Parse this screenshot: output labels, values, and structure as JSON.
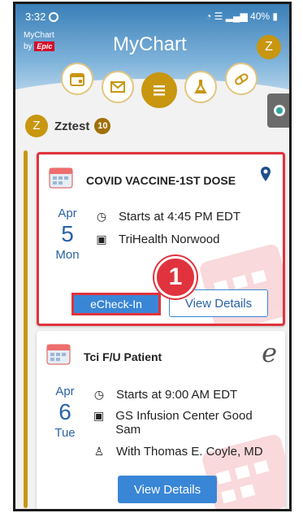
{
  "status_bar": {
    "time": "3:32",
    "battery": "40%"
  },
  "header": {
    "logo_line1": "MyChart",
    "logo_line2": "by",
    "logo_epic": "Epic",
    "brand_title": "MyChart",
    "avatar_initial": "Z"
  },
  "nav": {
    "icons": [
      "calendar-icon",
      "mail-icon",
      "menu-icon",
      "lab-flask-icon",
      "pill-icon"
    ],
    "active": "menu-icon"
  },
  "user": {
    "initial": "Z",
    "name": "Zztest",
    "badge_count": "10"
  },
  "appointments": [
    {
      "title": "COVID VACCINE-1ST DOSE",
      "month": "Apr",
      "day": "5",
      "weekday": "Mon",
      "time": "Starts at 4:45 PM EDT",
      "location": "TriHealth Norwood",
      "checkin_label": "eCheck-In",
      "details_label": "View Details",
      "step_number": "1",
      "type_icon": "location-pin-icon"
    },
    {
      "title": "Tci F/U Patient",
      "month": "Apr",
      "day": "6",
      "weekday": "Tue",
      "time": "Starts at 9:00 AM EDT",
      "location": "GS Infusion Center Good Sam",
      "provider": "With Thomas E. Coyle, MD",
      "details_label": "View Details",
      "type_icon": "e-visit-icon"
    }
  ],
  "colors": {
    "header_blue": "#3a7fb8",
    "accent_gold": "#c8960f",
    "link_blue": "#2b63a8",
    "button_blue": "#3a86d6",
    "highlight_red": "#e0333d"
  }
}
